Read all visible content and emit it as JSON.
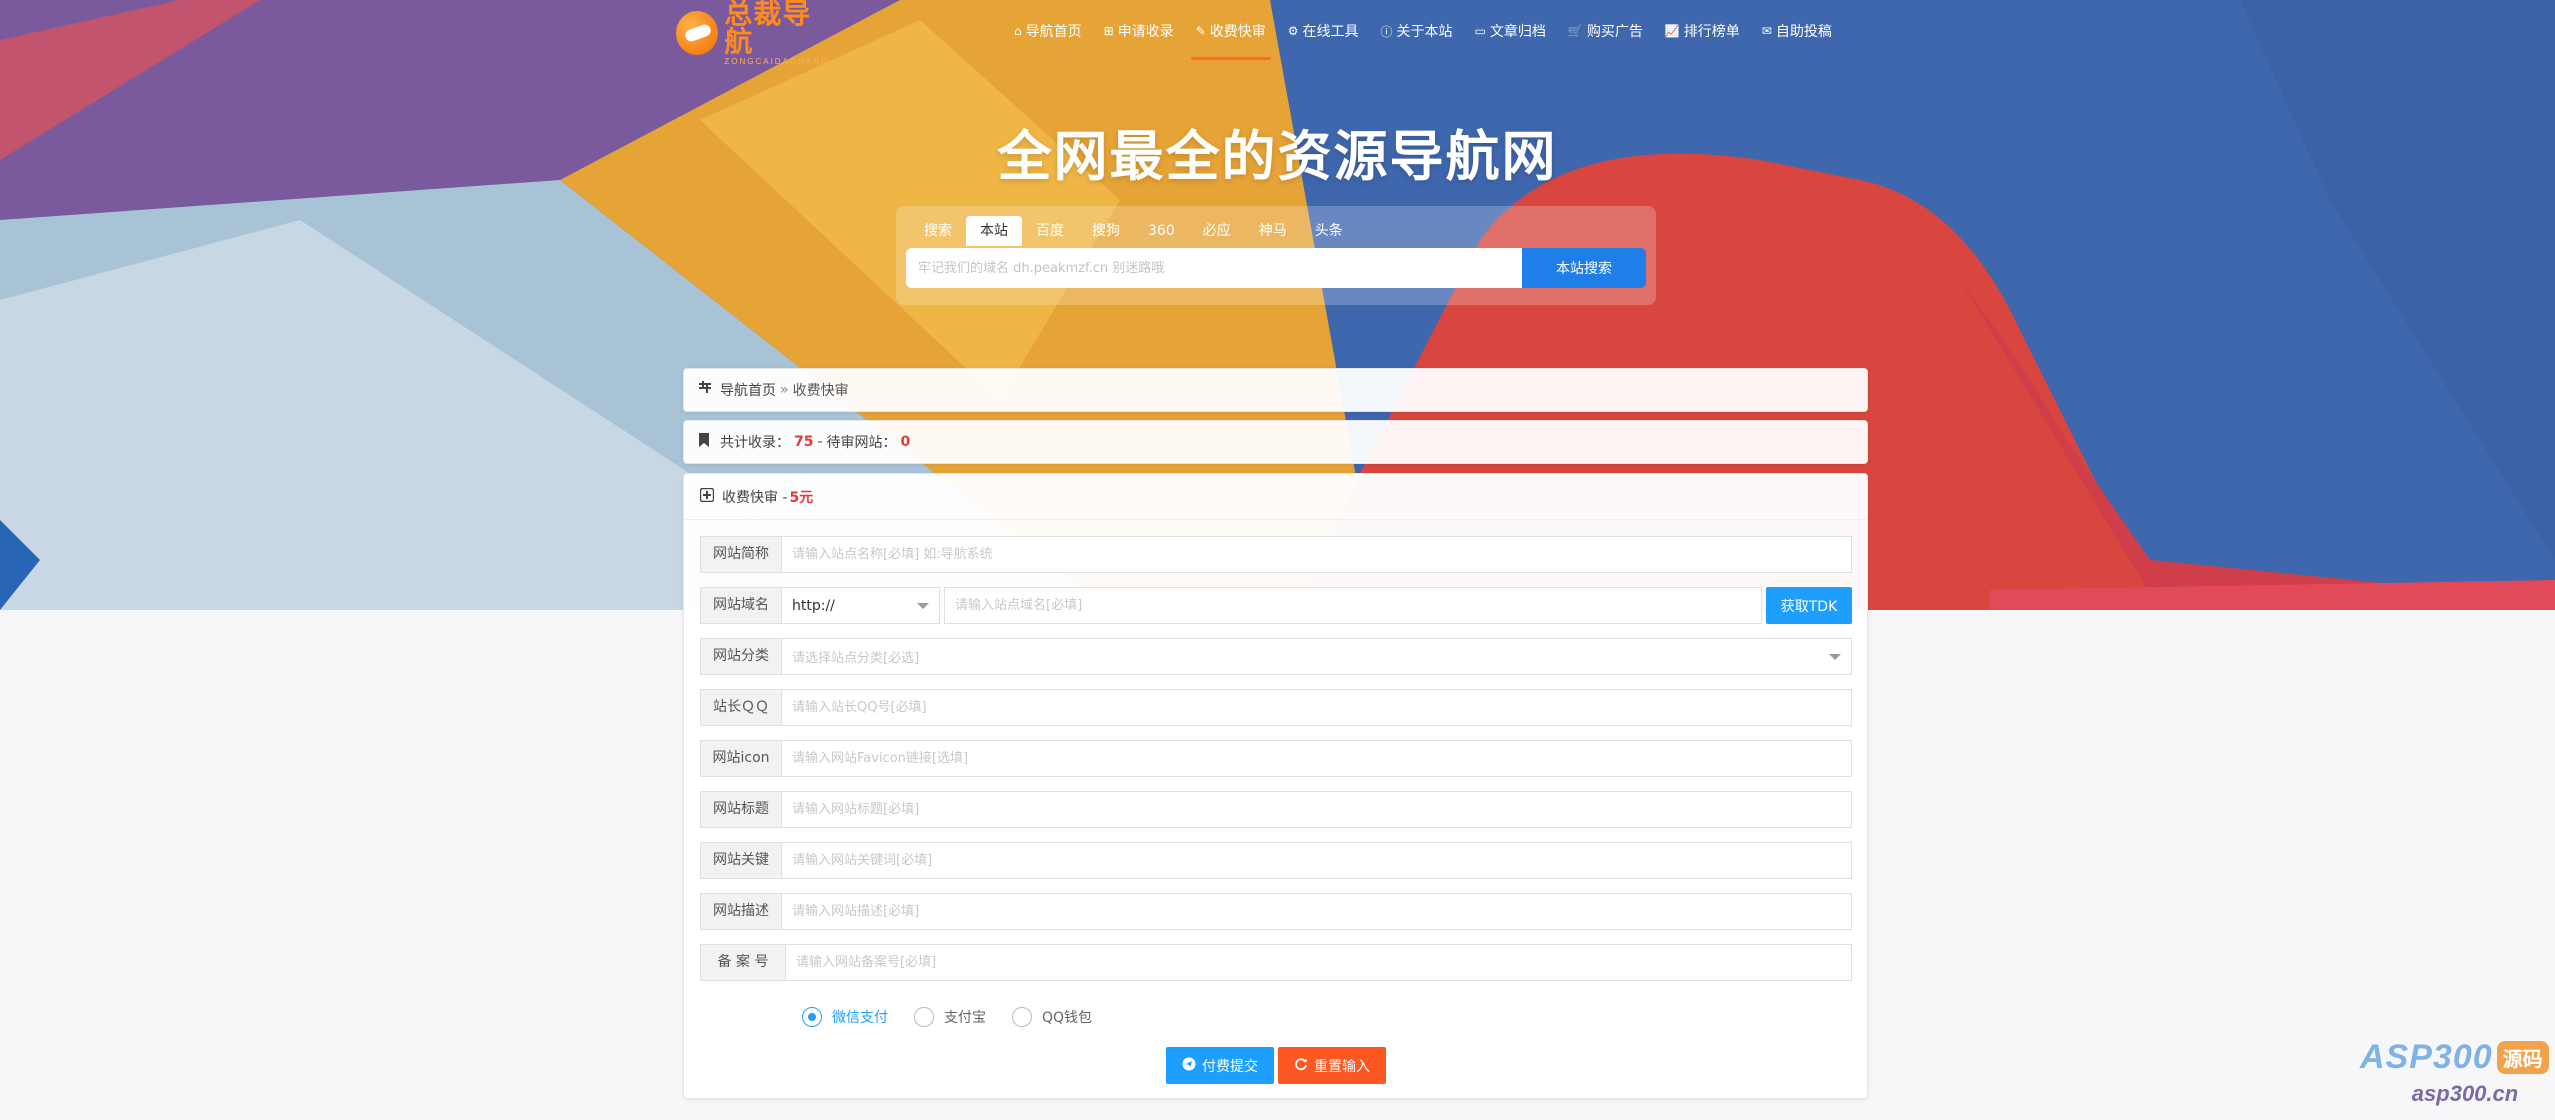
{
  "header": {
    "logo_cn": "总裁导航",
    "logo_en": "ZONGCAIDAOHANG",
    "nav": [
      {
        "icon": "⌂",
        "label": "导航首页",
        "icon_name": "home-icon"
      },
      {
        "icon": "⊞",
        "label": "申请收录",
        "icon_name": "plus-square-icon"
      },
      {
        "icon": "✎",
        "label": "收费快审",
        "icon_name": "paid-review-icon",
        "active": true
      },
      {
        "icon": "⚙",
        "label": "在线工具",
        "icon_name": "gears-icon"
      },
      {
        "icon": "ⓘ",
        "label": "关于本站",
        "icon_name": "info-icon"
      },
      {
        "icon": "▭",
        "label": "文章归档",
        "icon_name": "folder-icon"
      },
      {
        "icon": "🛒",
        "label": "购买广告",
        "icon_name": "cart-icon"
      },
      {
        "icon": "📈",
        "label": "排行榜单",
        "icon_name": "chart-line-icon"
      },
      {
        "icon": "✉",
        "label": "自助投稿",
        "icon_name": "envelope-icon"
      }
    ]
  },
  "hero": {
    "title": "全网最全的资源导航网"
  },
  "search": {
    "tabs": [
      "搜索",
      "本站",
      "百度",
      "搜狗",
      "360",
      "必应",
      "神马",
      "头条"
    ],
    "active_tab": "本站",
    "placeholder": "牢记我们的域名 dh.peakmzf.cn 别迷路哦",
    "button": "本站搜索"
  },
  "breadcrumb": {
    "icon": "toggle-icon",
    "home": "导航首页",
    "sep": "»",
    "current": "收费快审"
  },
  "stats": {
    "label_total": "共计收录：",
    "total": "75",
    "sep": "-",
    "label_pending": "待审网站：",
    "pending": "0"
  },
  "form": {
    "title": "收费快审 -",
    "price": "5元",
    "fields": {
      "name": {
        "label": "网站简称",
        "placeholder": "请输入站点名称[必填] 如:导航系统"
      },
      "domain": {
        "label": "网站域名",
        "protocol": "http://",
        "placeholder": "请输入站点域名[必填]",
        "button": "获取TDK"
      },
      "category": {
        "label": "网站分类",
        "placeholder": "请选择站点分类[必选]"
      },
      "qq": {
        "label": "站长ＱＱ",
        "placeholder": "请输入站长QQ号[必填]"
      },
      "icon": {
        "label": "网站icon",
        "placeholder": "请输入网站Favicon链接[选填]"
      },
      "title": {
        "label": "网站标题",
        "placeholder": "请输入网站标题[必填]"
      },
      "keywords": {
        "label": "网站关键",
        "placeholder": "请输入网站关键词[必填]"
      },
      "description": {
        "label": "网站描述",
        "placeholder": "请输入网站描述[必填]"
      },
      "icp": {
        "label": "备 案 号",
        "placeholder": "请输入网站备案号[必填]"
      }
    },
    "payment": {
      "options": [
        "微信支付",
        "支付宝",
        "QQ钱包"
      ],
      "selected": "微信支付"
    },
    "buttons": {
      "submit": "付费提交",
      "reset": "重置输入"
    }
  },
  "watermark": {
    "main": "ASP300",
    "badge": "源码",
    "url": "asp300.cn"
  },
  "colors": {
    "accent_blue": "#1e9fff",
    "accent_orange": "#ff5722",
    "highlight_red": "#e53935",
    "nav_active_underline": "#ff6b2c",
    "logo_orange": "#ff8a1e"
  }
}
